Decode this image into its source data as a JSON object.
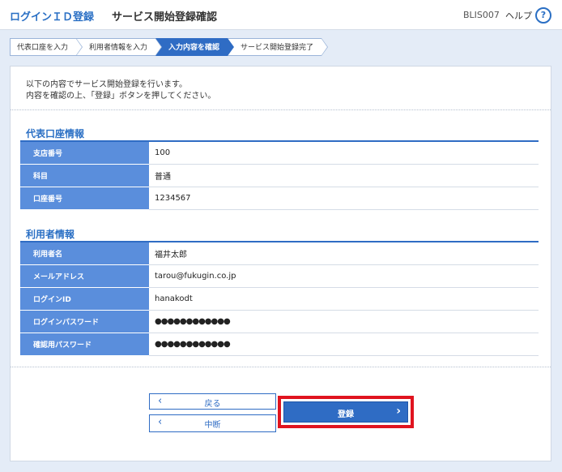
{
  "header": {
    "app_title": "ログインＩＤ登録",
    "screen_title": "サービス開始登録確認",
    "screen_id": "BLIS007",
    "help_label": "ヘルプ",
    "help_icon": "?"
  },
  "steps": [
    {
      "label": "代表口座を入力",
      "active": false
    },
    {
      "label": "利用者情報を入力",
      "active": false
    },
    {
      "label": "入力内容を確認",
      "active": true
    },
    {
      "label": "サービス開始登録完了",
      "active": false
    }
  ],
  "intro": {
    "line1": "以下の内容でサービス開始登録を行います。",
    "line2": "内容を確認の上、「登録」ボタンを押してください。"
  },
  "account_section": {
    "title": "代表口座情報",
    "rows": [
      {
        "label": "支店番号",
        "value": "100"
      },
      {
        "label": "科目",
        "value": "普通"
      },
      {
        "label": "口座番号",
        "value": "1234567"
      }
    ]
  },
  "user_section": {
    "title": "利用者情報",
    "rows": [
      {
        "label": "利用者名",
        "value": "福井太郎"
      },
      {
        "label": "メールアドレス",
        "value": "tarou@fukugin.co.jp"
      },
      {
        "label": "ログインID",
        "value": "hanakodt"
      },
      {
        "label": "ログインパスワード",
        "value": "●●●●●●●●●●●●"
      },
      {
        "label": "確認用パスワード",
        "value": "●●●●●●●●●●●●"
      }
    ]
  },
  "buttons": {
    "back_label": "戻る",
    "cancel_label": "中断",
    "register_label": "登録"
  },
  "colors": {
    "accent": "#2f6cc4",
    "highlight_frame": "#e0141f",
    "row_header": "#5a8edc"
  }
}
